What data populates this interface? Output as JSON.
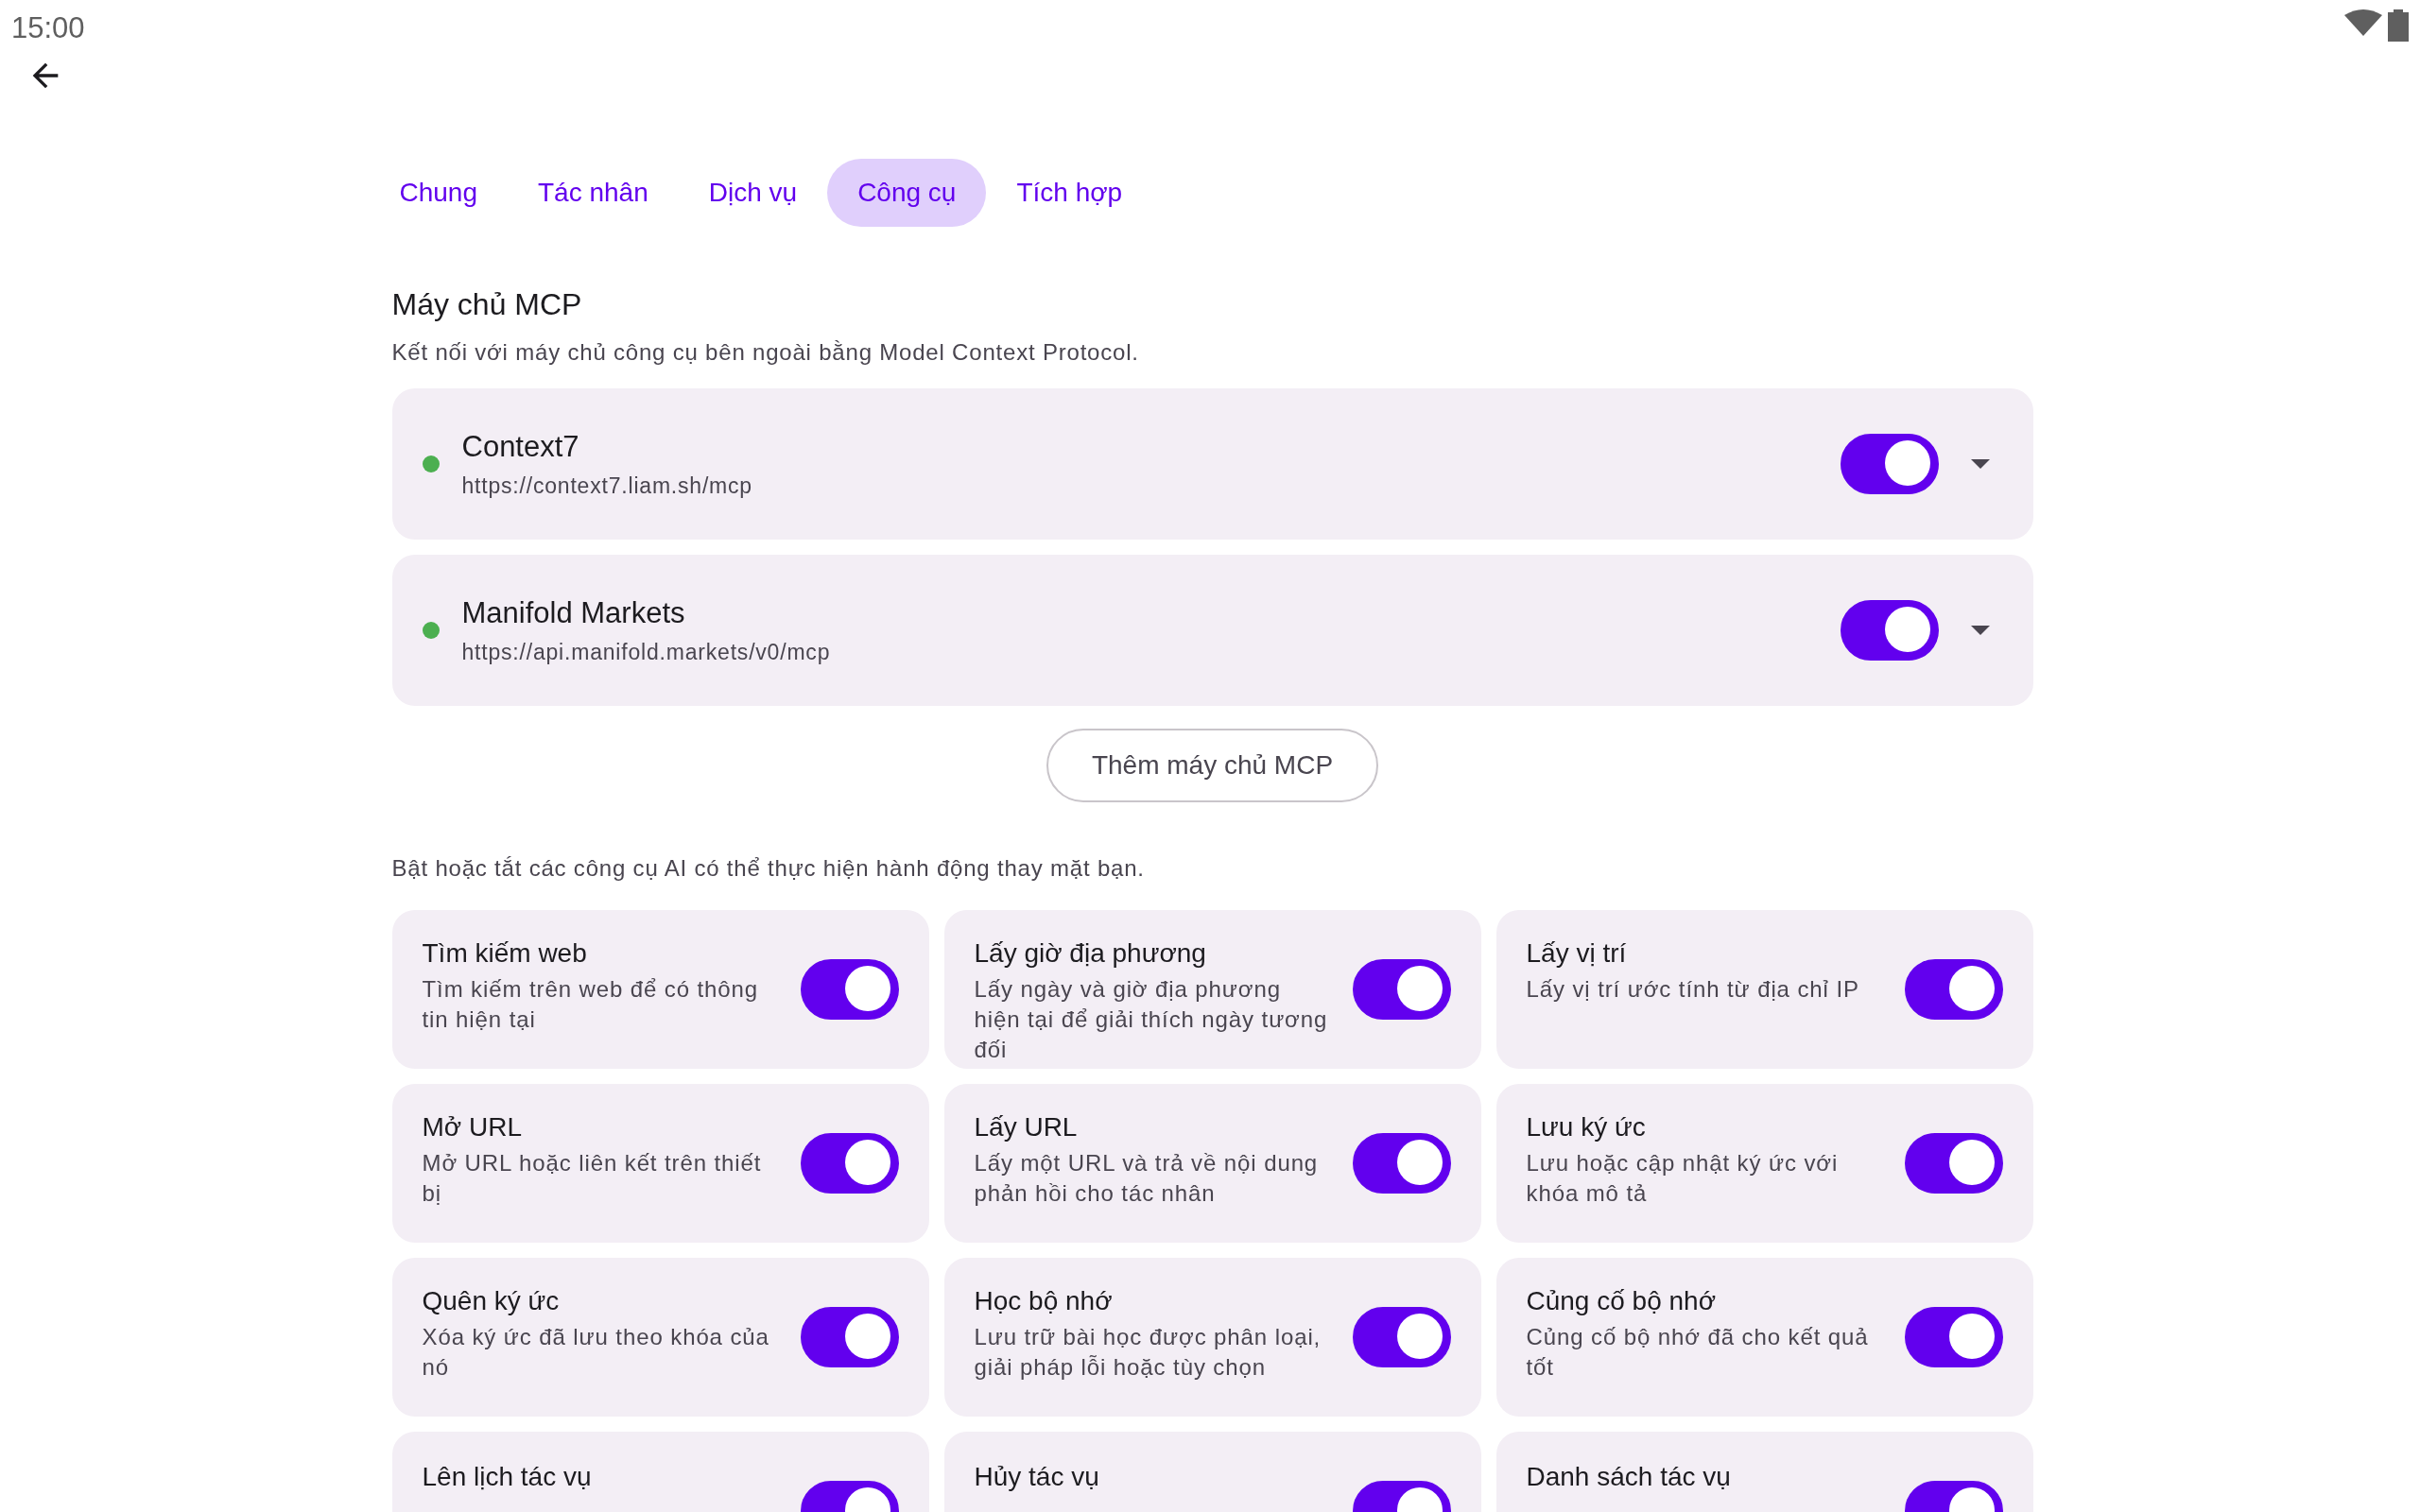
{
  "status_bar": {
    "time": "15:00"
  },
  "tabs": [
    {
      "label": "Chung",
      "selected": false
    },
    {
      "label": "Tác nhân",
      "selected": false
    },
    {
      "label": "Dịch vụ",
      "selected": false
    },
    {
      "label": "Công cụ",
      "selected": true
    },
    {
      "label": "Tích hợp",
      "selected": false
    }
  ],
  "mcp_section": {
    "title": "Máy chủ MCP",
    "description": "Kết nối với máy chủ công cụ bên ngoài bằng Model Context Protocol.",
    "servers": [
      {
        "name": "Context7",
        "url": "https://context7.liam.sh/mcp",
        "color": "#4caf50",
        "on": true,
        "expanded": false
      },
      {
        "name": "Manifold Markets",
        "url": "https://api.manifold.markets/v0/mcp",
        "color": "#4caf50",
        "on": true,
        "expanded": false
      }
    ],
    "add_button": "Thêm máy chủ MCP"
  },
  "tools_section": {
    "description": "Bật hoặc tắt các công cụ AI có thể thực hiện hành động thay mặt bạn.",
    "tools": [
      {
        "name": "Tìm kiếm web",
        "description": "Tìm kiếm trên web để có thông tin hiện tại",
        "on": true
      },
      {
        "name": "Lấy giờ địa phương",
        "description": "Lấy ngày và giờ địa phương hiện tại để giải thích ngày tương đối",
        "on": true
      },
      {
        "name": "Lấy vị trí",
        "description": "Lấy vị trí ước tính từ địa chỉ IP",
        "on": true
      },
      {
        "name": "Mở URL",
        "description": "Mở URL hoặc liên kết trên thiết bị",
        "on": true
      },
      {
        "name": "Lấy URL",
        "description": "Lấy một URL và trả về nội dung phản hồi cho tác nhân",
        "on": true
      },
      {
        "name": "Lưu ký ức",
        "description": "Lưu hoặc cập nhật ký ức với khóa mô tả",
        "on": true
      },
      {
        "name": "Quên ký ức",
        "description": "Xóa ký ức đã lưu theo khóa của nó",
        "on": true
      },
      {
        "name": "Học bộ nhớ",
        "description": "Lưu trữ bài học được phân loại, giải pháp lỗi hoặc tùy chọn",
        "on": true
      },
      {
        "name": "Củng cố bộ nhớ",
        "description": "Củng cố bộ nhớ đã cho kết quả tốt",
        "on": true
      },
      {
        "name": "Lên lịch tác vụ",
        "on": true
      },
      {
        "name": "Hủy tác vụ",
        "on": true
      },
      {
        "name": "Danh sách tác vụ",
        "on": true
      }
    ]
  }
}
